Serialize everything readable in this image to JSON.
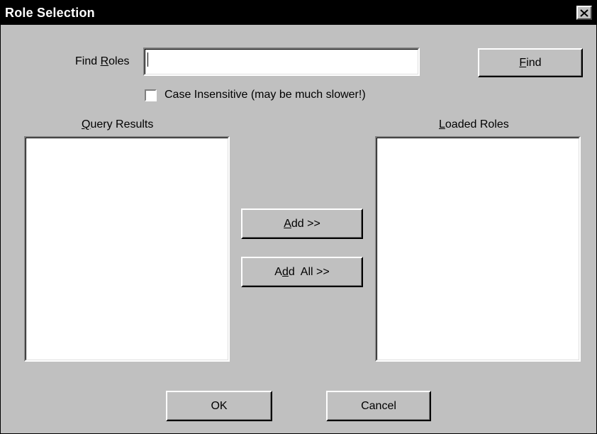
{
  "window": {
    "title": "Role Selection",
    "close_icon": "close-icon"
  },
  "find": {
    "label_prefix": "Find ",
    "label_underlined": "R",
    "label_suffix": "oles",
    "input_value": "",
    "button_underlined": "F",
    "button_rest": "ind"
  },
  "case_insensitive": {
    "label": "Case Insensitive (may be much slower!)",
    "checked": false
  },
  "query_results": {
    "label_underlined": "Q",
    "label_rest": "uery Results",
    "items": []
  },
  "loaded_roles": {
    "label_underlined": "L",
    "label_rest": "oaded Roles",
    "items": []
  },
  "add_button": {
    "underlined": "A",
    "rest": "dd >>"
  },
  "add_all_button": {
    "prefix": "A",
    "underlined": "d",
    "rest": "d  All >>"
  },
  "footer": {
    "ok_label": "OK",
    "cancel_label": "Cancel"
  }
}
